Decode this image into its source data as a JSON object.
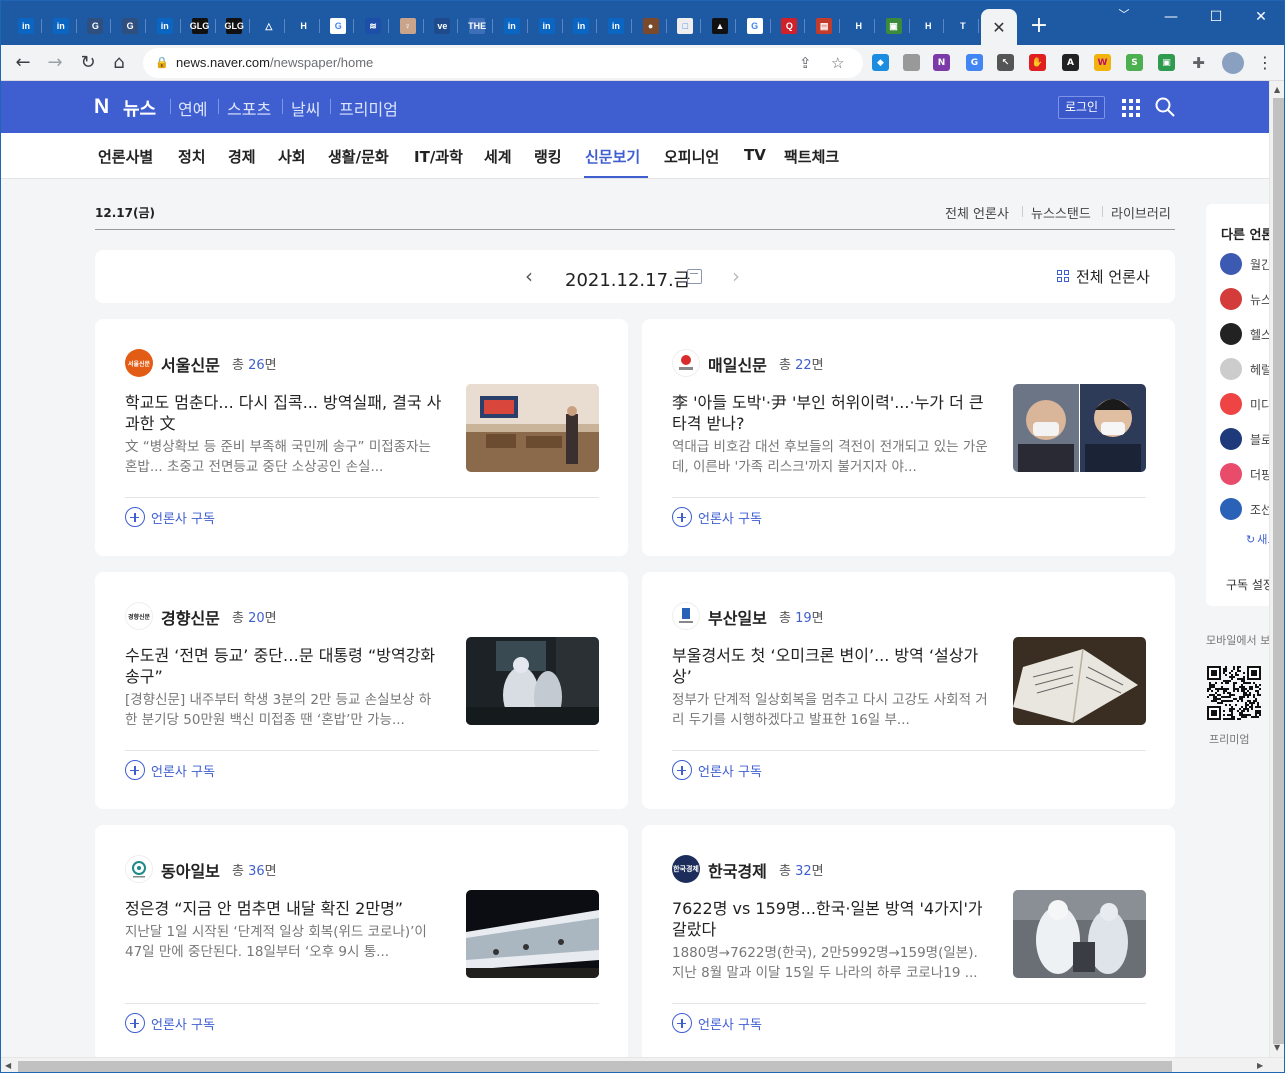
{
  "browser": {
    "tabs": [
      {
        "label": "in",
        "color": "#0a66c2"
      },
      {
        "label": "in",
        "color": "#0a66c2"
      },
      {
        "label": "G",
        "color": "#2f4f7f"
      },
      {
        "label": "G",
        "color": "#2f4f7f"
      },
      {
        "label": "in",
        "color": "#0a66c2"
      },
      {
        "label": "GLG",
        "color": "#111111"
      },
      {
        "label": "GLG",
        "color": "#111111"
      },
      {
        "label": "△",
        "color": "#1e5aa4"
      },
      {
        "label": "H",
        "color": "#1e5aa4"
      },
      {
        "label": "G",
        "color": "#ffffff"
      },
      {
        "label": "≋",
        "color": "#1d4fa8"
      },
      {
        "label": "♀",
        "color": "#c9a48a"
      },
      {
        "label": "ve",
        "color": "#1f4b8c"
      },
      {
        "label": "THE",
        "color": "#3d6fb8"
      },
      {
        "label": "in",
        "color": "#0a66c2"
      },
      {
        "label": "in",
        "color": "#0a66c2"
      },
      {
        "label": "in",
        "color": "#0a66c2"
      },
      {
        "label": "in",
        "color": "#0a66c2"
      },
      {
        "label": "●",
        "color": "#7a4a2a"
      },
      {
        "label": "□",
        "color": "#eeeeee"
      },
      {
        "label": "▲",
        "color": "#111111"
      },
      {
        "label": "G",
        "color": "#ffffff"
      },
      {
        "label": "Q",
        "color": "#d0202a"
      },
      {
        "label": "▤",
        "color": "#c33b2b"
      },
      {
        "label": "H",
        "color": "#1e5aa4"
      },
      {
        "label": "▣",
        "color": "#3c8a3c"
      },
      {
        "label": "H",
        "color": "#1e5aa4"
      },
      {
        "label": "T",
        "color": "#1e5aa4"
      }
    ],
    "active_tab_close": "✕",
    "new_tab": "+",
    "window": {
      "minimize": "﹀",
      "min": "—",
      "max": "☐",
      "close": "✕"
    },
    "url_host": "news.naver.com",
    "url_path": "/newspaper/home"
  },
  "naver": {
    "logo": "N",
    "title": "뉴스",
    "gnb": [
      "연예",
      "스포츠",
      "날씨",
      "프리미엄"
    ],
    "login": "로그인",
    "categories": [
      "언론사별",
      "정치",
      "경제",
      "사회",
      "생활/문화",
      "IT/과학",
      "세계",
      "랭킹",
      "신문보기",
      "오피니언",
      "TV",
      "팩트체크"
    ],
    "active_category": "신문보기"
  },
  "topbar": {
    "date": "12.17(금)",
    "links": [
      "전체 언론사",
      "뉴스스탠드",
      "라이브러리"
    ]
  },
  "datepicker": {
    "prev": "‹",
    "date": "2021.12.17.금",
    "next": "›",
    "all_press": "전체 언론사"
  },
  "cards": [
    {
      "press": "서울신문",
      "count_prefix": "총 ",
      "count": "26",
      "count_suffix": "면",
      "logo_color": "#e35c15",
      "logo_text": "서울신문",
      "headline": "학교도 멈춘다... 다시 집콕... 방역실패, 결국 사과한 文",
      "summary": "文 “병상확보 등 준비 부족해 국민께 송구” 미접종자는 혼밥... 초중고 전면등교 중단 소상공인 손실...",
      "subscribe": "언론사 구독"
    },
    {
      "press": "매일신문",
      "count_prefix": "총 ",
      "count": "22",
      "count_suffix": "면",
      "logo_color": "#ffffff",
      "logo_text": "매일신문",
      "headline": "李 '아들 도박'·尹 '부인 허위이력'...·누가 더 큰 타격 받나?",
      "summary": "역대급 비호감 대선 후보들의 격전이 전개되고 있는 가운데, 이른바 '가족 리스크'까지 불거지자 야...",
      "subscribe": "언론사 구독"
    },
    {
      "press": "경향신문",
      "count_prefix": "총 ",
      "count": "20",
      "count_suffix": "면",
      "logo_color": "#ffffff",
      "logo_text": "경향신문",
      "headline": "수도권 ‘전면 등교’ 중단…문 대통령 “방역강화 송구”",
      "summary": "[경향신문] 내주부터 학생 3분의 2만 등교 손실보상 하한 분기당 50만원 백신 미접종 땐 ‘혼밥’만 가능...",
      "subscribe": "언론사 구독"
    },
    {
      "press": "부산일보",
      "count_prefix": "총 ",
      "count": "19",
      "count_suffix": "면",
      "logo_color": "#ffffff",
      "logo_text": "부산일보",
      "headline": "부울경서도 첫 ‘오미크론 변이’... 방역 ‘설상가상’",
      "summary": "정부가 단계적 일상회복을 멈추고 다시 고강도 사회적 거리 두기를 시행하겠다고 발표한 16일 부...",
      "subscribe": "언론사 구독"
    },
    {
      "press": "동아일보",
      "count_prefix": "총 ",
      "count": "36",
      "count_suffix": "면",
      "logo_color": "#ffffff",
      "logo_text": "동아일보",
      "headline": "정은경 “지금 안 멈추면 내달 확진 2만명”",
      "summary": "지난달 1일 시작된 ‘단계적 일상 회복(위드 코로나)’이 47일 만에 중단된다. 18일부터 ‘오후 9시 통...",
      "subscribe": "언론사 구독"
    },
    {
      "press": "한국경제",
      "count_prefix": "총 ",
      "count": "32",
      "count_suffix": "면",
      "logo_color": "#1c2d5c",
      "logo_text": "한국경제",
      "headline": "7622명 vs 159명...한국·일본 방역 '4가지'가 갈랐다",
      "summary": "1880명→7622명(한국), 2만5992명→159명(일본). 지난 8월 말과 이달 15일 두 나라의 하루 코로나19 ...",
      "subscribe": "언론사 구독"
    }
  ],
  "sidebar": {
    "title": "다른 언론사",
    "items": [
      {
        "name": "월간",
        "color": "#3c5ab2"
      },
      {
        "name": "뉴스",
        "color": "#d43b3b"
      },
      {
        "name": "헬스",
        "color": "#222222"
      },
      {
        "name": "헤럴",
        "color": "#cccccc"
      },
      {
        "name": "미디",
        "color": "#e44"
      },
      {
        "name": "블로",
        "color": "#1f3a7a"
      },
      {
        "name": "더핑",
        "color": "#e94b6a"
      },
      {
        "name": "조선",
        "color": "#2a62b8"
      }
    ],
    "more": "새로고침",
    "subscribe_settings": "구독 설정",
    "mobile_label": "모바일에서 보기",
    "qr_label": "프리미엄"
  }
}
